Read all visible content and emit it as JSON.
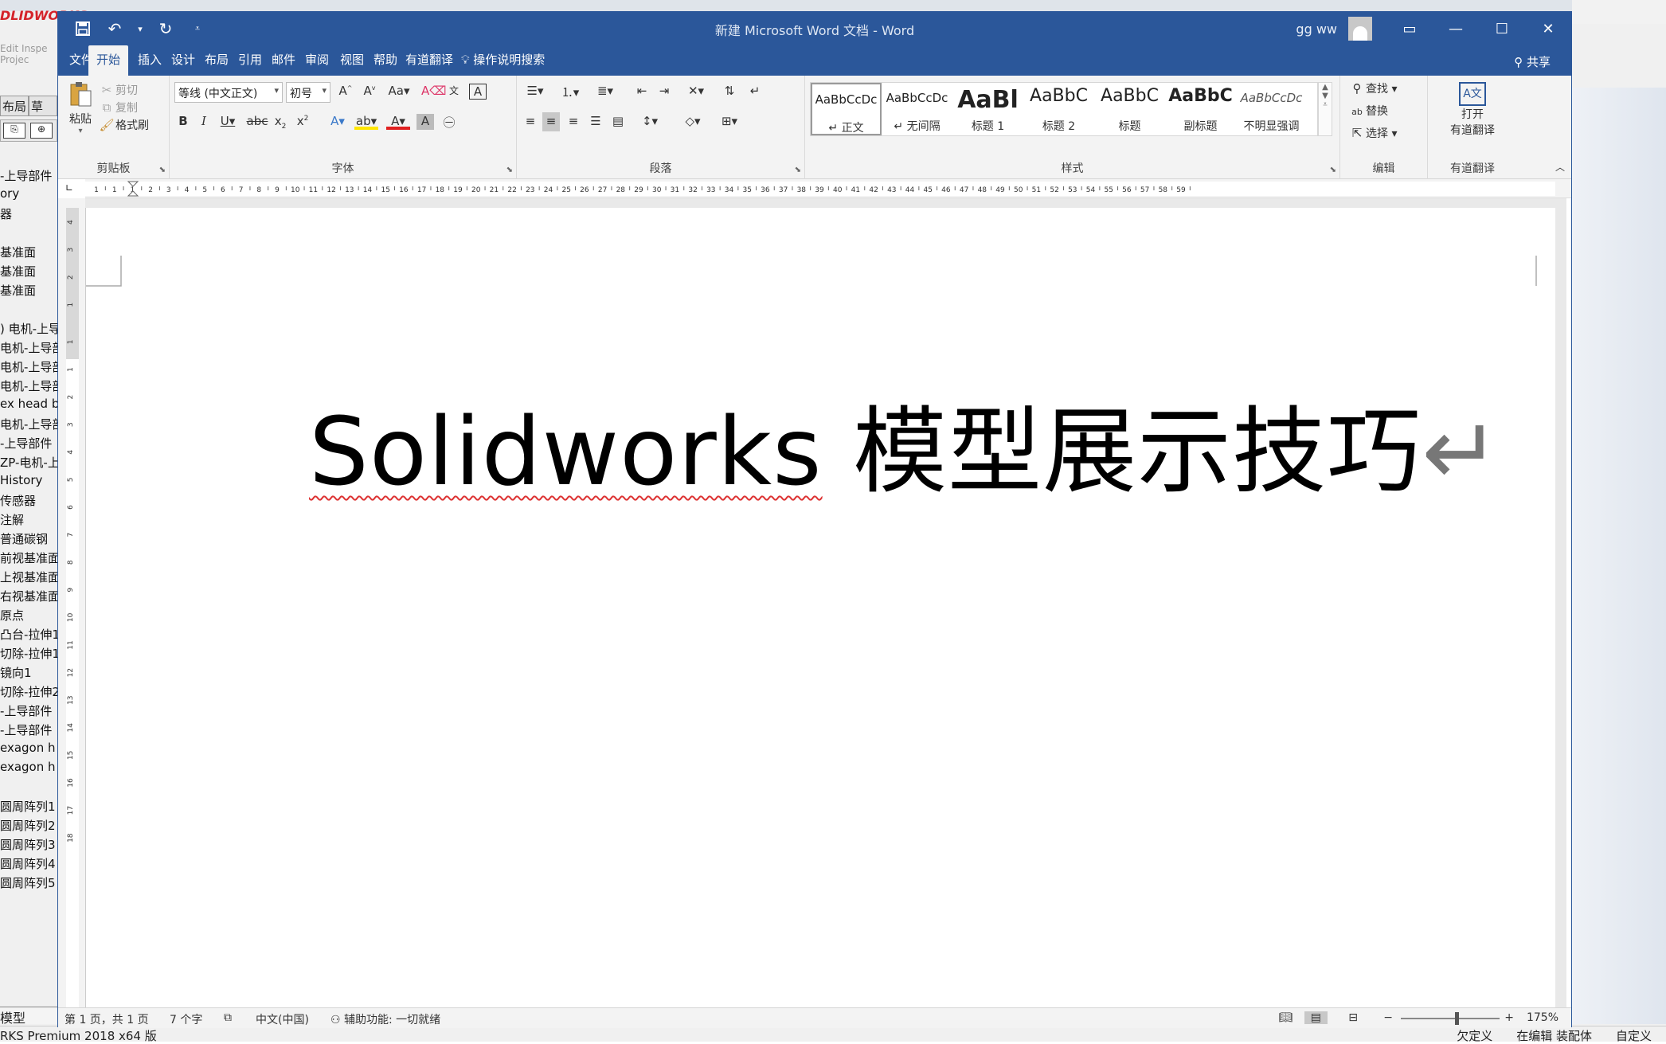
{
  "solidworks": {
    "logo": "DLIDWORKS",
    "toolbar_hint": "Edit Inspe Projec",
    "tabs": [
      "布局",
      "草"
    ],
    "tree_items": [
      "-上导部件",
      "ory",
      "器",
      "",
      "基准面",
      "基准面",
      "基准面",
      "",
      ") 电机-上导",
      "电机-上导部",
      "电机-上导部",
      "电机-上导部",
      "ex head b",
      "电机-上导部",
      "-上导部件",
      "ZP-电机-上",
      "History",
      "传感器",
      "注解",
      "普通碳钢",
      "前视基准面",
      "上视基准面",
      "右视基准面",
      "原点",
      "凸台-拉伸1",
      "切除-拉伸1",
      "镜向1",
      "切除-拉伸2",
      "-上导部件",
      "-上导部件",
      "exagon h",
      "exagon h",
      "",
      "圆周阵列1",
      "圆周阵列2",
      "圆周阵列3",
      "圆周阵列4",
      "圆周阵列5"
    ],
    "bottom_tab": "模型",
    "status_left": "RKS Premium 2018 x64 版",
    "status_right": [
      "欠定义",
      "在编辑 装配体",
      "自定义"
    ]
  },
  "word": {
    "title": "新建 Microsoft Word 文档  -  Word",
    "user": "gg ww",
    "tabs": [
      "文件",
      "开始",
      "插入",
      "设计",
      "布局",
      "引用",
      "邮件",
      "审阅",
      "视图",
      "帮助",
      "有道翻译"
    ],
    "active_tab": "开始",
    "tell_me": "操作说明搜索",
    "share": "共享",
    "clipboard": {
      "paste": "粘贴",
      "cut": "剪切",
      "copy": "复制",
      "format_painter": "格式刷",
      "label": "剪贴板"
    },
    "font": {
      "font_name": "等线 (中文正文)",
      "font_size": "初号",
      "label": "字体"
    },
    "paragraph": {
      "label": "段落"
    },
    "styles": {
      "label": "样式",
      "items": [
        {
          "sample": "AaBbCcDc",
          "name": "↵ 正文",
          "size": 15,
          "bold": false,
          "italic": false
        },
        {
          "sample": "AaBbCcDc",
          "name": "↵ 无间隔",
          "size": 15,
          "bold": false,
          "italic": false
        },
        {
          "sample": "AaBl",
          "name": "标题 1",
          "size": 30,
          "bold": true,
          "italic": false
        },
        {
          "sample": "AaBbC",
          "name": "标题 2",
          "size": 22,
          "bold": false,
          "italic": false
        },
        {
          "sample": "AaBbC",
          "name": "标题",
          "size": 22,
          "bold": false,
          "italic": false
        },
        {
          "sample": "AaBbC",
          "name": "副标题",
          "size": 22,
          "bold": true,
          "italic": false
        },
        {
          "sample": "AaBbCcDc",
          "name": "不明显强调",
          "size": 15,
          "bold": false,
          "italic": true
        }
      ],
      "selected_index": 0
    },
    "editing": {
      "find": "查找",
      "replace": "替换",
      "select": "选择",
      "label": "编辑"
    },
    "youdao": {
      "open": "打开",
      "open2": "有道翻译",
      "label": "有道翻译"
    },
    "document": {
      "text_latin": "Solidworks",
      "text_cjk": " 模型展示技巧",
      "para_mark": "↵"
    },
    "status": {
      "page": "第 1 页，共 1 页",
      "words": "7 个字",
      "language": "中文(中国)",
      "accessibility": "辅助功能: 一切就绪",
      "zoom": "175%"
    },
    "hruler_numbers": [
      "1",
      "1",
      "1",
      "2",
      "3",
      "4",
      "5",
      "6",
      "7",
      "8",
      "9",
      "10",
      "11",
      "12",
      "13",
      "14",
      "15",
      "16",
      "17",
      "18",
      "19",
      "20",
      "21",
      "22",
      "23",
      "24",
      "25",
      "26",
      "27",
      "28",
      "29",
      "30",
      "31",
      "32",
      "33",
      "34",
      "35",
      "36",
      "37",
      "38",
      "39",
      "40",
      "41",
      "42",
      "43",
      "44",
      "45",
      "46",
      "47",
      "48",
      "49",
      "50",
      "51",
      "52",
      "53",
      "54",
      "55",
      "56",
      "57",
      "58",
      "59"
    ],
    "vruler_numbers": [
      "4",
      "3",
      "2",
      "1",
      "1",
      "1",
      "2",
      "3",
      "4",
      "5",
      "6",
      "7",
      "8",
      "9",
      "10",
      "11",
      "12",
      "13",
      "14",
      "15",
      "16",
      "17",
      "18"
    ]
  }
}
